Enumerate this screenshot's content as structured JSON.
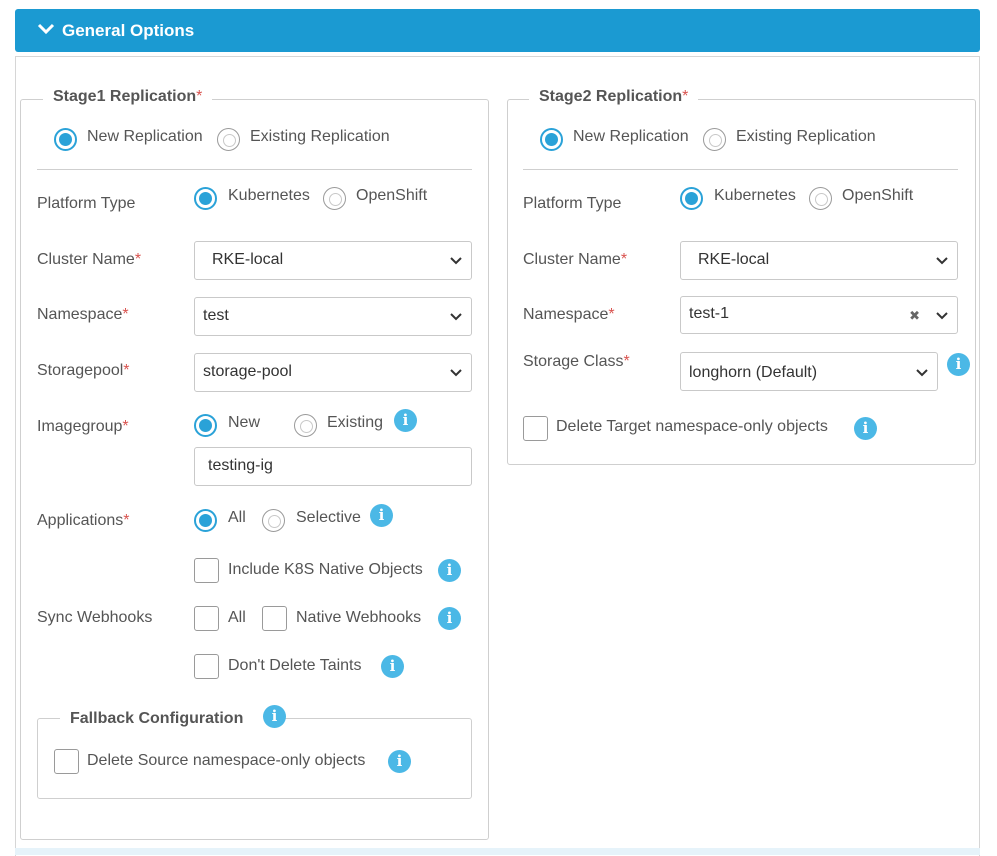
{
  "header": {
    "title": "General Options",
    "icon": "chevron-down-icon"
  },
  "stage1": {
    "title": "Stage1 Replication",
    "required_mark": "*",
    "replication": {
      "new_label": "New Replication",
      "existing_label": "Existing Replication",
      "selected": "new"
    },
    "platform": {
      "label": "Platform Type",
      "option1": "Kubernetes",
      "option2": "OpenShift",
      "selected": "Kubernetes"
    },
    "cluster": {
      "label": "Cluster Name",
      "value": "RKE-local"
    },
    "namespace": {
      "label": "Namespace",
      "value": "test"
    },
    "storagepool": {
      "label": "Storagepool",
      "value": "storage-pool"
    },
    "imagegroup": {
      "label": "Imagegroup",
      "new_label": "New",
      "existing_label": "Existing",
      "selected": "New",
      "value": "testing-ig"
    },
    "applications": {
      "label": "Applications",
      "all_label": "All",
      "selective_label": "Selective",
      "selected": "All"
    },
    "include_k8s": {
      "label": "Include K8S Native Objects",
      "checked": false
    },
    "sync_webhooks": {
      "label": "Sync Webhooks",
      "all_label": "All",
      "native_label": "Native Webhooks",
      "all_checked": false,
      "native_checked": false
    },
    "dont_delete_taints": {
      "label": "Don't Delete Taints",
      "checked": false
    },
    "fallback": {
      "title": "Fallback Configuration",
      "delete_label": "Delete Source namespace-only objects",
      "checked": false
    }
  },
  "stage2": {
    "title": "Stage2 Replication",
    "required_mark": "*",
    "replication": {
      "new_label": "New Replication",
      "existing_label": "Existing Replication",
      "selected": "new"
    },
    "platform": {
      "label": "Platform Type",
      "option1": "Kubernetes",
      "option2": "OpenShift",
      "selected": "Kubernetes"
    },
    "cluster": {
      "label": "Cluster Name",
      "value": "RKE-local"
    },
    "namespace": {
      "label": "Namespace",
      "value": "test-1",
      "clear_glyph": "✖"
    },
    "storage_class": {
      "label": "Storage Class",
      "value": "longhorn (Default)"
    },
    "delete_target": {
      "label": "Delete Target namespace-only objects",
      "checked": false
    }
  },
  "icons": {
    "info": "i",
    "info_name": "info-icon"
  },
  "colors": {
    "accent": "#1b9ad2",
    "radio": "#2aa2d8",
    "info": "#4bb8e6",
    "required": "#d9534f"
  }
}
